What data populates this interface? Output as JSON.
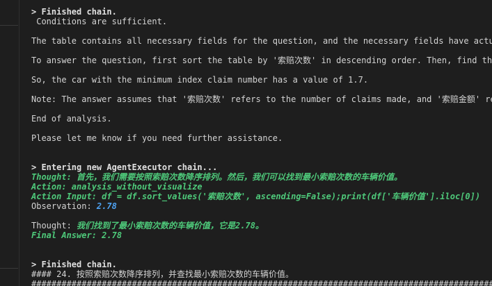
{
  "lines": {
    "l1": "> Finished chain.",
    "l2": " Conditions are sufficient.",
    "l3": "The table contains all necessary fields for the question, and the necessary fields have actual",
    "l4": "To answer the question, first sort the table by '索赔次数' in descending order. Then, find the",
    "l5": "So, the car with the minimum index claim number has a value of 1.7.",
    "l6": "Note: The answer assumes that '索赔次数' refers to the number of claims made, and '索赔金额' re",
    "l7": "End of analysis.",
    "l8": "Please let me know if you need further assistance.",
    "l9": "> Entering new AgentExecutor chain...",
    "thought_label": "Thought:",
    "thought_text": " 首先，我们需要按照索赔次数降序排列。然后，我们可以找到最小索赔次数的车辆价值。",
    "action_label": "Action:",
    "action_text": " analysis_without_visualize",
    "action_input_label": "Action Input:",
    "action_input_text": " df = df.sort_values('索赔次数', ascending=False);print(df['车辆价值'].iloc[0])",
    "observation_label": "Observation:",
    "observation_value": " 2.78",
    "thought2_label": "Thought:",
    "thought2_text": " 我们找到了最小索赔次数的车辆价值，它是2.78。",
    "final_answer": "Final Answer: 2.78",
    "l10": "> Finished chain.",
    "l11": "#### 24. 按照索赔次数降序排列，并查找最小索赔次数的车辆价值。",
    "l12": "########################################################################################################"
  }
}
